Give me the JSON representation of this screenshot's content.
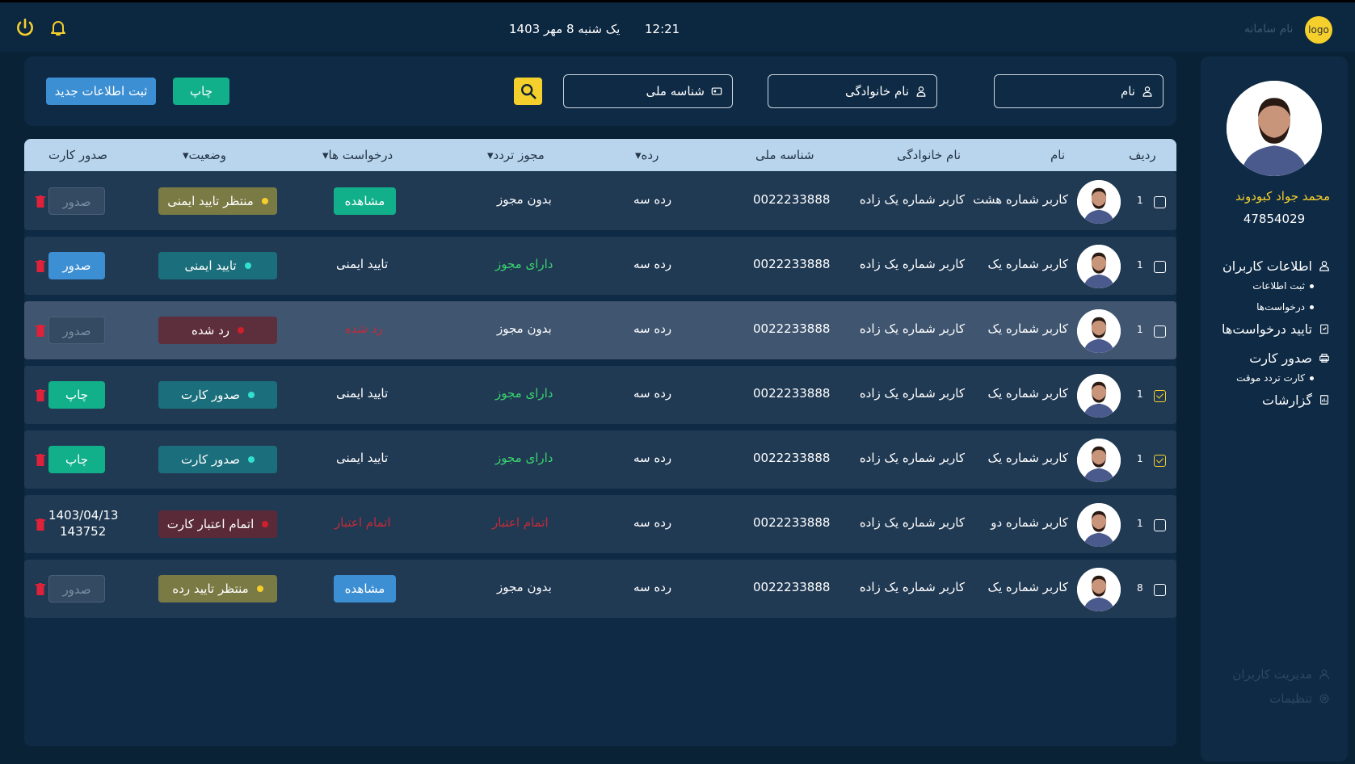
{
  "topbar": {
    "date": "یک شنبه 8 مهر 1403",
    "time": "12:21",
    "logo": "logo",
    "system_name": "نام سامانه",
    "icons": [
      "power-icon",
      "bell-icon"
    ]
  },
  "sidebar": {
    "user_name": "محمد جواد کبودوند",
    "user_id": "47854029",
    "menu": [
      {
        "label": "اطلاعات کاربران",
        "icon": "user-icon"
      },
      {
        "label": "ثبت اطلاعات",
        "sub": true
      },
      {
        "label": "درخواست‌ها",
        "sub": true
      },
      {
        "label": "تایید درخواست‌ها",
        "icon": "clipboard-icon"
      },
      {
        "label": "صدور کارت",
        "icon": "printer-icon"
      },
      {
        "label": "کارت تردد موقت",
        "sub": true
      },
      {
        "label": "گزارشات",
        "icon": "report-icon"
      }
    ],
    "bottom_menu": [
      {
        "label": "مدیریت کاربران",
        "icon": "users-icon"
      },
      {
        "label": "تنظیمات",
        "icon": "settings-icon"
      }
    ]
  },
  "filters": {
    "first_name": "نام",
    "last_name": "نام خانوادگی",
    "national_id": "شناسه ملی",
    "print_label": "چاپ",
    "new_label": "ثبت اطلاعات جدید"
  },
  "table": {
    "headers": {
      "row": "ردیف",
      "name": "نام",
      "family": "نام خانوادگی",
      "nid": "شناسه ملی",
      "level": "رده",
      "permit": "مجوز تردد",
      "requests": "درخواست ها",
      "status": "وضعیت",
      "card": "صدور کارت"
    },
    "rows": [
      {
        "checked": false,
        "num": "1",
        "name": "کاربر شماره هشت",
        "family": "کاربر شماره یک زاده",
        "nid": "0022233888",
        "level": "رده سه",
        "permit": "بدون مجوز",
        "request": "مشاهده",
        "status": "منتظر تایید ایمنی",
        "card": "صدور"
      },
      {
        "checked": false,
        "num": "1",
        "name": "کاربر شماره یک",
        "family": "کاربر شماره یک زاده",
        "nid": "0022233888",
        "level": "رده سه",
        "permit": "دارای مجوز",
        "request": "تایید ایمنی",
        "status": "تایید ایمنی",
        "card": "صدور"
      },
      {
        "checked": false,
        "num": "1",
        "name": "کاربر شماره یک",
        "family": "کاربر شماره یک زاده",
        "nid": "0022233888",
        "level": "رده سه",
        "permit": "بدون مجوز",
        "request": "رد شده",
        "status": "رد شده",
        "card": "صدور"
      },
      {
        "checked": true,
        "num": "1",
        "name": "کاربر شماره یک",
        "family": "کاربر شماره یک زاده",
        "nid": "0022233888",
        "level": "رده سه",
        "permit": "دارای مجوز",
        "request": "تایید ایمنی",
        "status": "صدور کارت",
        "card": "چاپ"
      },
      {
        "checked": true,
        "num": "1",
        "name": "کاربر شماره یک",
        "family": "کاربر شماره یک زاده",
        "nid": "0022233888",
        "level": "رده سه",
        "permit": "دارای مجوز",
        "request": "تایید ایمنی",
        "status": "صدور کارت",
        "card": "چاپ"
      },
      {
        "checked": false,
        "num": "1",
        "name": "کاربر شماره دو",
        "family": "کاربر شماره یک زاده",
        "nid": "0022233888",
        "level": "رده سه",
        "permit": "اتمام اعتبار",
        "request": "اتمام اعتبار",
        "status": "اتمام اعتبار کارت",
        "card_date": "1403/04/13",
        "card_no": "143752"
      },
      {
        "checked": false,
        "num": "8",
        "name": "کاربر شماره یک",
        "family": "کاربر شماره یک زاده",
        "nid": "0022233888",
        "level": "رده سه",
        "permit": "بدون مجوز",
        "request": "مشاهده",
        "status": "منتظر تایید رده",
        "card": "صدور"
      }
    ]
  },
  "colors": {
    "accent_yellow": "#f5cf2c",
    "teal": "#11b08a",
    "blue": "#3d8fd3",
    "green_text": "#3ad36e",
    "red_text": "#c42b38"
  }
}
